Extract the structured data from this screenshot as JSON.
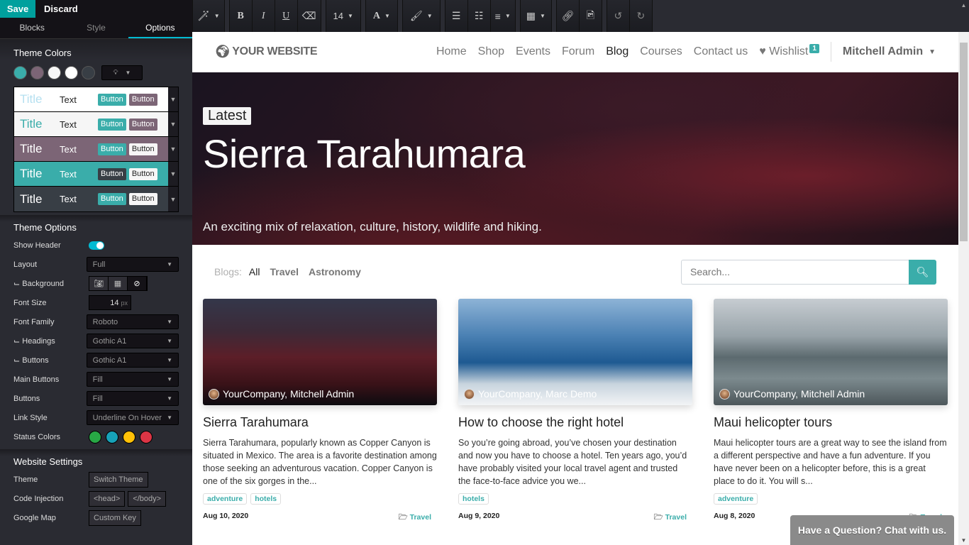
{
  "editor": {
    "save_label": "Save",
    "discard_label": "Discard",
    "tabs": [
      {
        "label": "Blocks"
      },
      {
        "label": "Style"
      },
      {
        "label": "Options",
        "active": true
      }
    ]
  },
  "theme_colors": {
    "heading": "Theme Colors",
    "swatches": [
      "#3aadaa",
      "#7c6576",
      "#f6f6f6",
      "#ffffff",
      "#383e45"
    ],
    "presets": [
      {
        "title": "Title",
        "text": "Text",
        "btn1": "Button",
        "btn2": "Button",
        "bg": "#ffffff",
        "title_color": "#b6e0f0",
        "text_color": "#222222",
        "btn1_bg": "#3aadaa",
        "btn1_fg": "#ffffff",
        "btn2_bg": "#7c6576",
        "btn2_fg": "#ffffff"
      },
      {
        "title": "Title",
        "text": "Text",
        "btn1": "Button",
        "btn2": "Button",
        "bg": "#f6f6f6",
        "title_color": "#3aadaa",
        "text_color": "#222222",
        "btn1_bg": "#3aadaa",
        "btn1_fg": "#ffffff",
        "btn2_bg": "#7c6576",
        "btn2_fg": "#ffffff"
      },
      {
        "title": "Title",
        "text": "Text",
        "btn1": "Button",
        "btn2": "Button",
        "bg": "#7c6576",
        "title_color": "#ffffff",
        "text_color": "#ffffff",
        "btn1_bg": "#3aadaa",
        "btn1_fg": "#ffffff",
        "btn2_bg": "#f6f6f6",
        "btn2_fg": "#222222"
      },
      {
        "title": "Title",
        "text": "Text",
        "btn1": "Button",
        "btn2": "Button",
        "bg": "#3aadaa",
        "title_color": "#ffffff",
        "text_color": "#ffffff",
        "btn1_bg": "#383e45",
        "btn1_fg": "#ffffff",
        "btn2_bg": "#f6f6f6",
        "btn2_fg": "#222222"
      },
      {
        "title": "Title",
        "text": "Text",
        "btn1": "Button",
        "btn2": "Button",
        "bg": "#383e45",
        "title_color": "#ffffff",
        "text_color": "#ffffff",
        "btn1_bg": "#3aadaa",
        "btn1_fg": "#ffffff",
        "btn2_bg": "#f6f6f6",
        "btn2_fg": "#222222"
      }
    ]
  },
  "theme_options": {
    "heading": "Theme Options",
    "show_header_label": "Show Header",
    "show_header_on": true,
    "layout_label": "Layout",
    "layout_value": "Full",
    "background_label": "⌙ Background",
    "font_size_label": "Font Size",
    "font_size_value": "14",
    "font_size_unit": "px",
    "font_family_label": "Font Family",
    "font_family_value": "Roboto",
    "headings_label": "⌙ Headings",
    "headings_value": "Gothic A1",
    "buttons_font_label": "⌙ Buttons",
    "buttons_font_value": "Gothic A1",
    "main_buttons_label": "Main Buttons",
    "main_buttons_value": "Fill",
    "buttons_label": "Buttons",
    "buttons_value": "Fill",
    "link_style_label": "Link Style",
    "link_style_value": "Underline On Hover",
    "status_colors_label": "Status Colors",
    "status_colors": [
      "#28a745",
      "#17a2b8",
      "#ffc107",
      "#dc3545"
    ]
  },
  "website_settings": {
    "heading": "Website Settings",
    "theme_label": "Theme",
    "theme_button": "Switch Theme",
    "code_injection_label": "Code Injection",
    "head_button": "<head>",
    "body_button": "</body>",
    "google_map_label": "Google Map",
    "custom_key_button": "Custom Key"
  },
  "toolbar": {
    "font_size": "14"
  },
  "site": {
    "logo": "YOUR WEBSITE",
    "nav": [
      {
        "label": "Home"
      },
      {
        "label": "Shop"
      },
      {
        "label": "Events"
      },
      {
        "label": "Forum"
      },
      {
        "label": "Blog",
        "active": true
      },
      {
        "label": "Courses"
      },
      {
        "label": "Contact us"
      }
    ],
    "wishlist_label": "Wishlist",
    "wishlist_count": "1",
    "user_name": "Mitchell Admin"
  },
  "hero": {
    "badge": "Latest",
    "title": "Sierra Tarahumara",
    "subtitle": "An exciting mix of relaxation, culture, history, wildlife and hiking."
  },
  "filters": {
    "label": "Blogs:",
    "items": [
      {
        "label": "All",
        "active": true
      },
      {
        "label": "Travel"
      },
      {
        "label": "Astronomy"
      }
    ],
    "search_placeholder": "Search..."
  },
  "posts": [
    {
      "author": "YourCompany, Mitchell Admin",
      "title": "Sierra Tarahumara",
      "excerpt": "Sierra Tarahumara, popularly known as Copper Canyon is situated in Mexico. The area is a favorite destination among those seeking an adventurous vacation. Copper Canyon is one of the six gorges in the...",
      "tags": [
        "adventure",
        "hotels"
      ],
      "date": "Aug 10, 2020",
      "category": "Travel"
    },
    {
      "author": "YourCompany, Marc Demo",
      "title": "How to choose the right hotel",
      "excerpt": "So you’re going abroad, you’ve chosen your destination and now you have to choose a hotel. Ten years ago, you’d have probably visited your local travel agent and trusted the face-to-face advice you we...",
      "tags": [
        "hotels"
      ],
      "date": "Aug 9, 2020",
      "category": "Travel"
    },
    {
      "author": "YourCompany, Mitchell Admin",
      "title": "Maui helicopter tours",
      "excerpt": "Maui helicopter tours are a great way to see the island from a different perspective and have a fun adventure. If you have never been on a helicopter before, this is a great place to do it. You will s...",
      "tags": [
        "adventure"
      ],
      "date": "Aug 8, 2020",
      "category": "Travel"
    }
  ],
  "chat": {
    "label": "Have a Question? Chat with us."
  }
}
